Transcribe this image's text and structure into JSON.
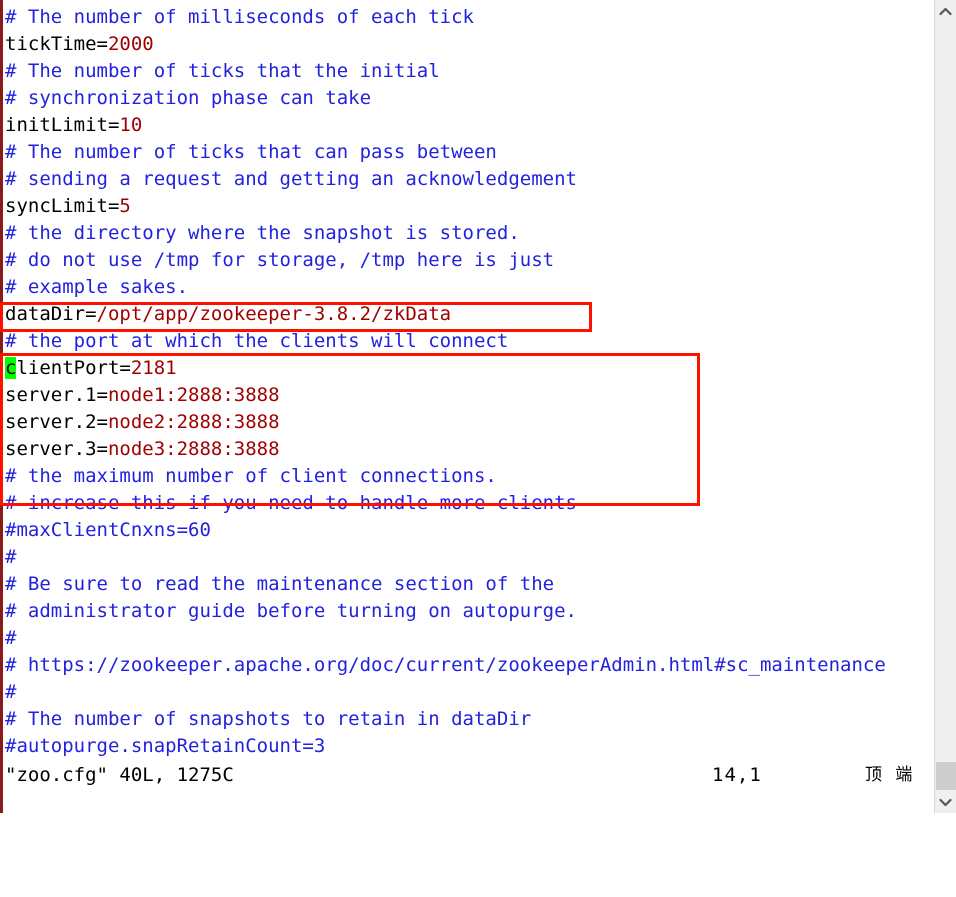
{
  "editor": {
    "file_name": "zoo.cfg",
    "lines": [
      {
        "type": "comment",
        "text": "# The number of milliseconds of each tick"
      },
      {
        "type": "setting",
        "key": "tickTime=",
        "value": "2000"
      },
      {
        "type": "comment",
        "text": "# The number of ticks that the initial"
      },
      {
        "type": "comment",
        "text": "# synchronization phase can take"
      },
      {
        "type": "setting",
        "key": "initLimit=",
        "value": "10"
      },
      {
        "type": "comment",
        "text": "# The number of ticks that can pass between"
      },
      {
        "type": "comment",
        "text": "# sending a request and getting an acknowledgement"
      },
      {
        "type": "setting",
        "key": "syncLimit=",
        "value": "5"
      },
      {
        "type": "comment",
        "text": "# the directory where the snapshot is stored."
      },
      {
        "type": "comment",
        "text": "# do not use /tmp for storage, /tmp here is just"
      },
      {
        "type": "comment",
        "text": "# example sakes."
      },
      {
        "type": "setting",
        "key": "dataDir=",
        "value": "/opt/app/zookeeper-3.8.2/zkData"
      },
      {
        "type": "comment",
        "text": "# the port at which the clients will connect"
      },
      {
        "type": "setting-cursor",
        "cursor_char": "c",
        "key": "lientPort=",
        "value": "2181"
      },
      {
        "type": "setting",
        "key": "server.1=",
        "value": "node1:2888:3888"
      },
      {
        "type": "setting",
        "key": "server.2=",
        "value": "node2:2888:3888"
      },
      {
        "type": "setting",
        "key": "server.3=",
        "value": "node3:2888:3888"
      },
      {
        "type": "comment",
        "text": "# the maximum number of client connections."
      },
      {
        "type": "comment",
        "text": "# increase this if you need to handle more clients"
      },
      {
        "type": "comment",
        "text": "#maxClientCnxns=60"
      },
      {
        "type": "comment",
        "text": "#"
      },
      {
        "type": "comment",
        "text": "# Be sure to read the maintenance section of the"
      },
      {
        "type": "comment",
        "text": "# administrator guide before turning on autopurge."
      },
      {
        "type": "comment",
        "text": "#"
      },
      {
        "type": "comment",
        "text": "# https://zookeeper.apache.org/doc/current/zookeeperAdmin.html#sc_maintenance"
      },
      {
        "type": "comment",
        "text": "#"
      },
      {
        "type": "comment",
        "text": "# The number of snapshots to retain in dataDir"
      },
      {
        "type": "comment",
        "text": "#autopurge.snapRetainCount=3"
      }
    ]
  },
  "status": {
    "file_info": "\"zoo.cfg\" 40L, 1275C",
    "cursor_position": "14,1",
    "scroll_position": "顶 端"
  },
  "annotations": [
    {
      "name": "datadir-highlight",
      "color": "#ff1100"
    },
    {
      "name": "server-block-highlight",
      "color": "#ff1100"
    }
  ],
  "scrollbar": {
    "up_arrow": "chevron-up-icon",
    "down_arrow": "chevron-down-icon"
  },
  "colors": {
    "comment": "#2222dd",
    "value": "#9f0000",
    "key": "#000000",
    "cursor_bg": "#00ff00",
    "annotation": "#ff1100",
    "background": "#ffffff"
  }
}
